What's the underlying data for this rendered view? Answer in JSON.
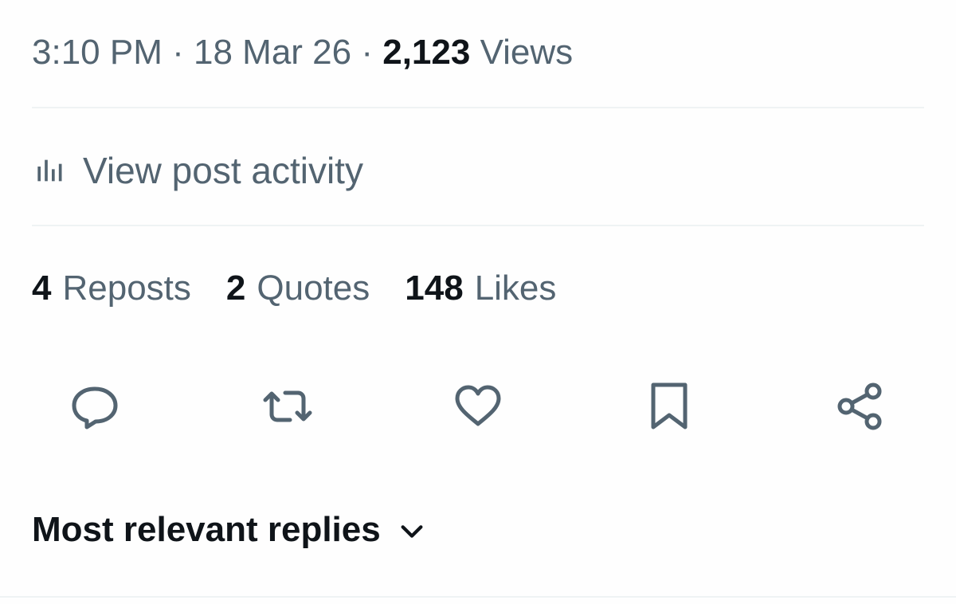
{
  "post_meta": {
    "time": "3:10 PM",
    "sep1": "·",
    "date": "18 Mar 26",
    "sep2": "·",
    "views_count": "2,123",
    "views_label": "Views"
  },
  "activity": {
    "label": "View post activity",
    "icon": "analytics-bars-icon"
  },
  "stats": [
    {
      "count": "4",
      "label": "Reposts"
    },
    {
      "count": "2",
      "label": "Quotes"
    },
    {
      "count": "148",
      "label": "Likes"
    }
  ],
  "actions": [
    {
      "name": "reply",
      "icon": "speech-bubble-icon"
    },
    {
      "name": "repost",
      "icon": "repost-arrows-icon"
    },
    {
      "name": "like",
      "icon": "heart-icon"
    },
    {
      "name": "bookmark",
      "icon": "bookmark-icon"
    },
    {
      "name": "share",
      "icon": "share-nodes-icon"
    }
  ],
  "replies_sort": {
    "label": "Most relevant replies",
    "icon": "chevron-down-icon"
  },
  "colors": {
    "primary_text": "#0f1419",
    "secondary_text": "#536471",
    "divider": "#eff3f4",
    "background": "#fefefe"
  }
}
